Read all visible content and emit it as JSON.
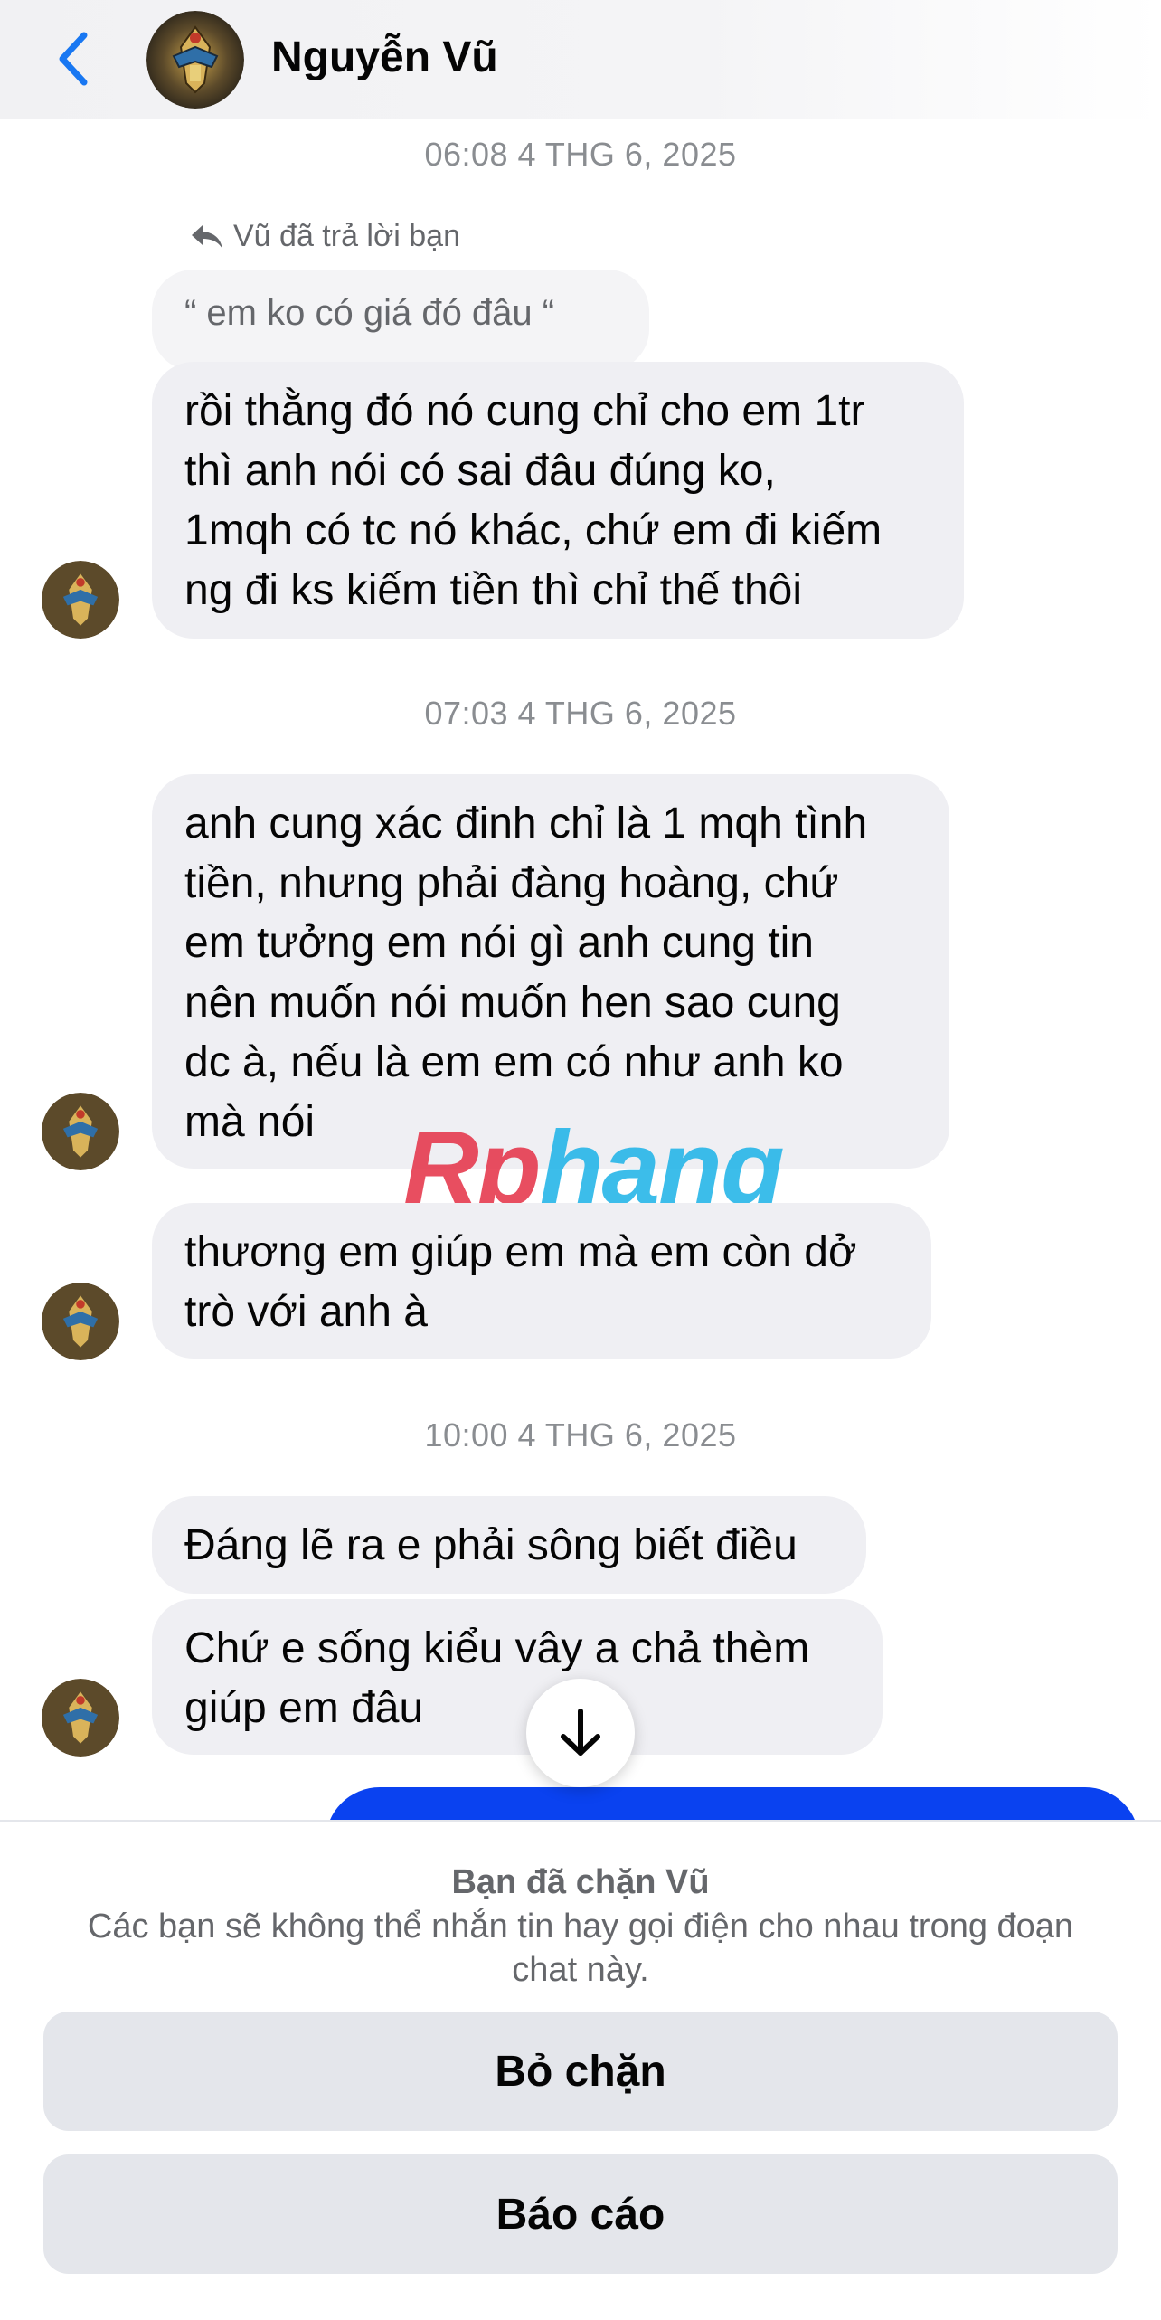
{
  "header": {
    "contact_name": "Nguyễn Vũ",
    "back_icon": "chevron-left-icon",
    "avatar": "pharaoh-avatar"
  },
  "thread": {
    "timestamps": [
      "06:08 4 THG 6, 2025",
      "07:03 4 THG 6, 2025",
      "10:00 4 THG 6, 2025"
    ],
    "reply_label": "Vũ đã trả lời bạn",
    "reply_quote": "“ em ko có giá đó đâu “",
    "messages": [
      {
        "lines": [
          "rồi thằng đó nó cung chỉ cho em 1tr",
          "thì anh nói có sai đâu đúng ko,",
          "1mqh có tc nó khác, chứ em đi kiếm",
          "ng đi ks kiếm tiền thì chỉ thế thôi"
        ]
      },
      {
        "lines": [
          "anh cung xác đinh chỉ là 1 mqh tình",
          "tiền, nhưng phải đàng hoàng, chứ",
          "em tưởng em nói gì anh cung tin",
          "nên muốn nói muốn hen sao cung",
          "dc à, nếu là em em có như anh ko",
          "mà nói"
        ]
      },
      {
        "lines": [
          "thương em giúp em mà em còn dở",
          "trò với anh à"
        ]
      },
      {
        "lines": [
          "Đáng lẽ ra e phải sông biết điều"
        ]
      },
      {
        "lines": [
          "Chứ e sống kiểu vây a chả thèm",
          "giúp em đâu"
        ]
      }
    ]
  },
  "watermark": {
    "part1": "Rp",
    "part2": "hang"
  },
  "blocked": {
    "title": "Bạn đã chặn Vũ",
    "description": "Các bạn sẽ không thể nhắn tin hay gọi điện cho nhau trong đoạn chat này.",
    "unblock_label": "Bỏ chặn",
    "report_label": "Báo cáo"
  },
  "colors": {
    "accent": "#0a42f0",
    "back_arrow": "#1877f2",
    "bubble_in": "#efeff3"
  }
}
